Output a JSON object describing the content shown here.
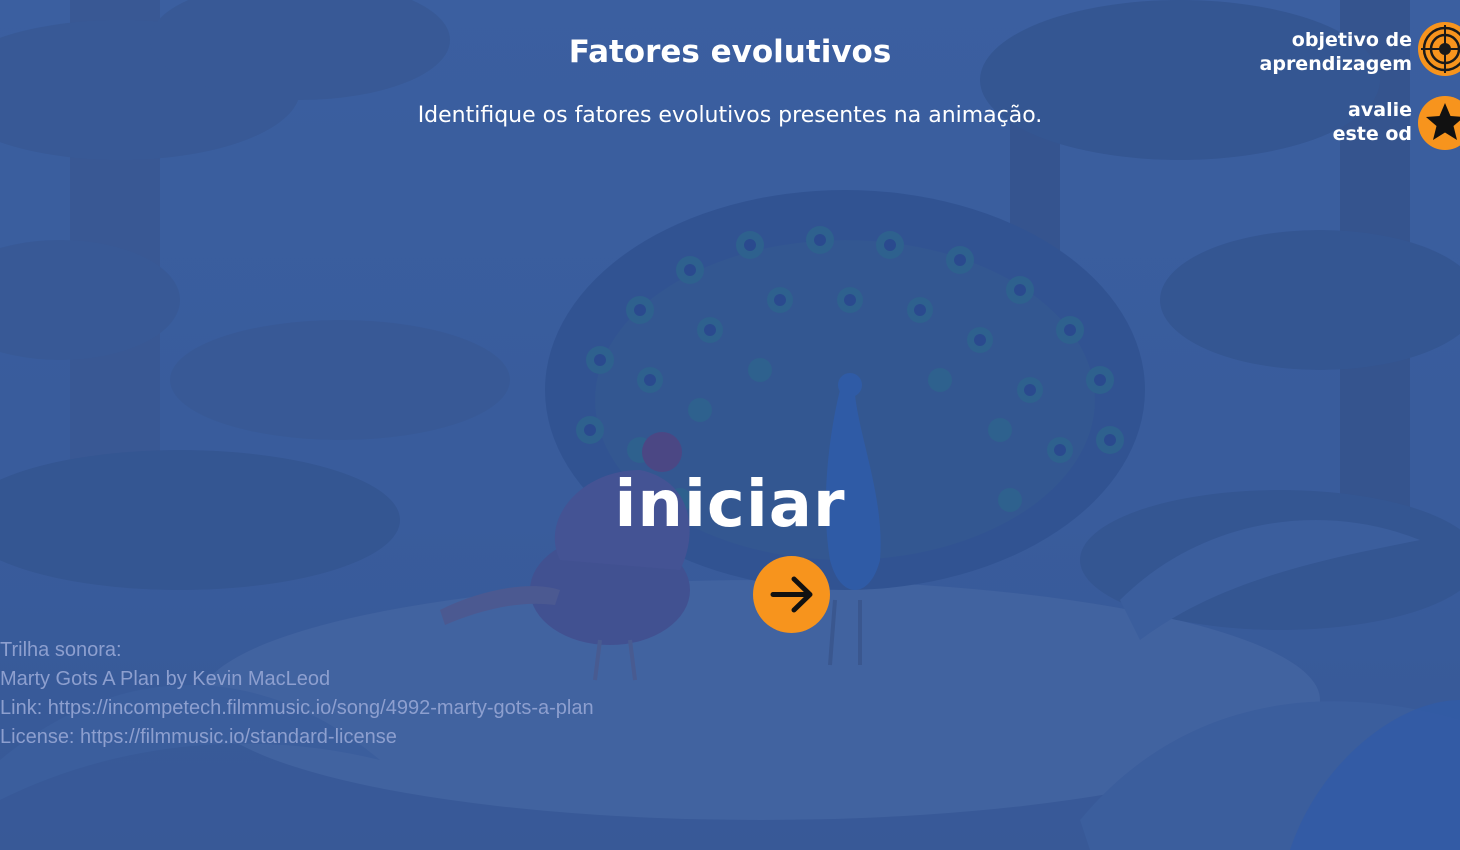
{
  "header": {
    "title": "Fatores evolutivos",
    "subtitle": "Identifique os fatores evolutivos presentes na animação."
  },
  "side_links": {
    "objective": {
      "line1": "objetivo de",
      "line2": "aprendizagem",
      "icon": "target-icon"
    },
    "rate": {
      "line1": "avalie",
      "line2": "este od",
      "icon": "star-icon"
    }
  },
  "start": {
    "label": "iniciar",
    "icon": "arrow-right-icon"
  },
  "credits": {
    "line1": "Trilha sonora:",
    "line2": "Marty Gots A Plan by Kevin MacLeod",
    "line3": "Link: https://incompetech.filmmusic.io/song/4992-marty-gots-a-plan",
    "line4": "License: https://filmmusic.io/standard-license"
  },
  "colors": {
    "background": "#3a5f9e",
    "accent": "#f7941d",
    "text": "#ffffff",
    "credits_text": "#8d9fcf"
  }
}
